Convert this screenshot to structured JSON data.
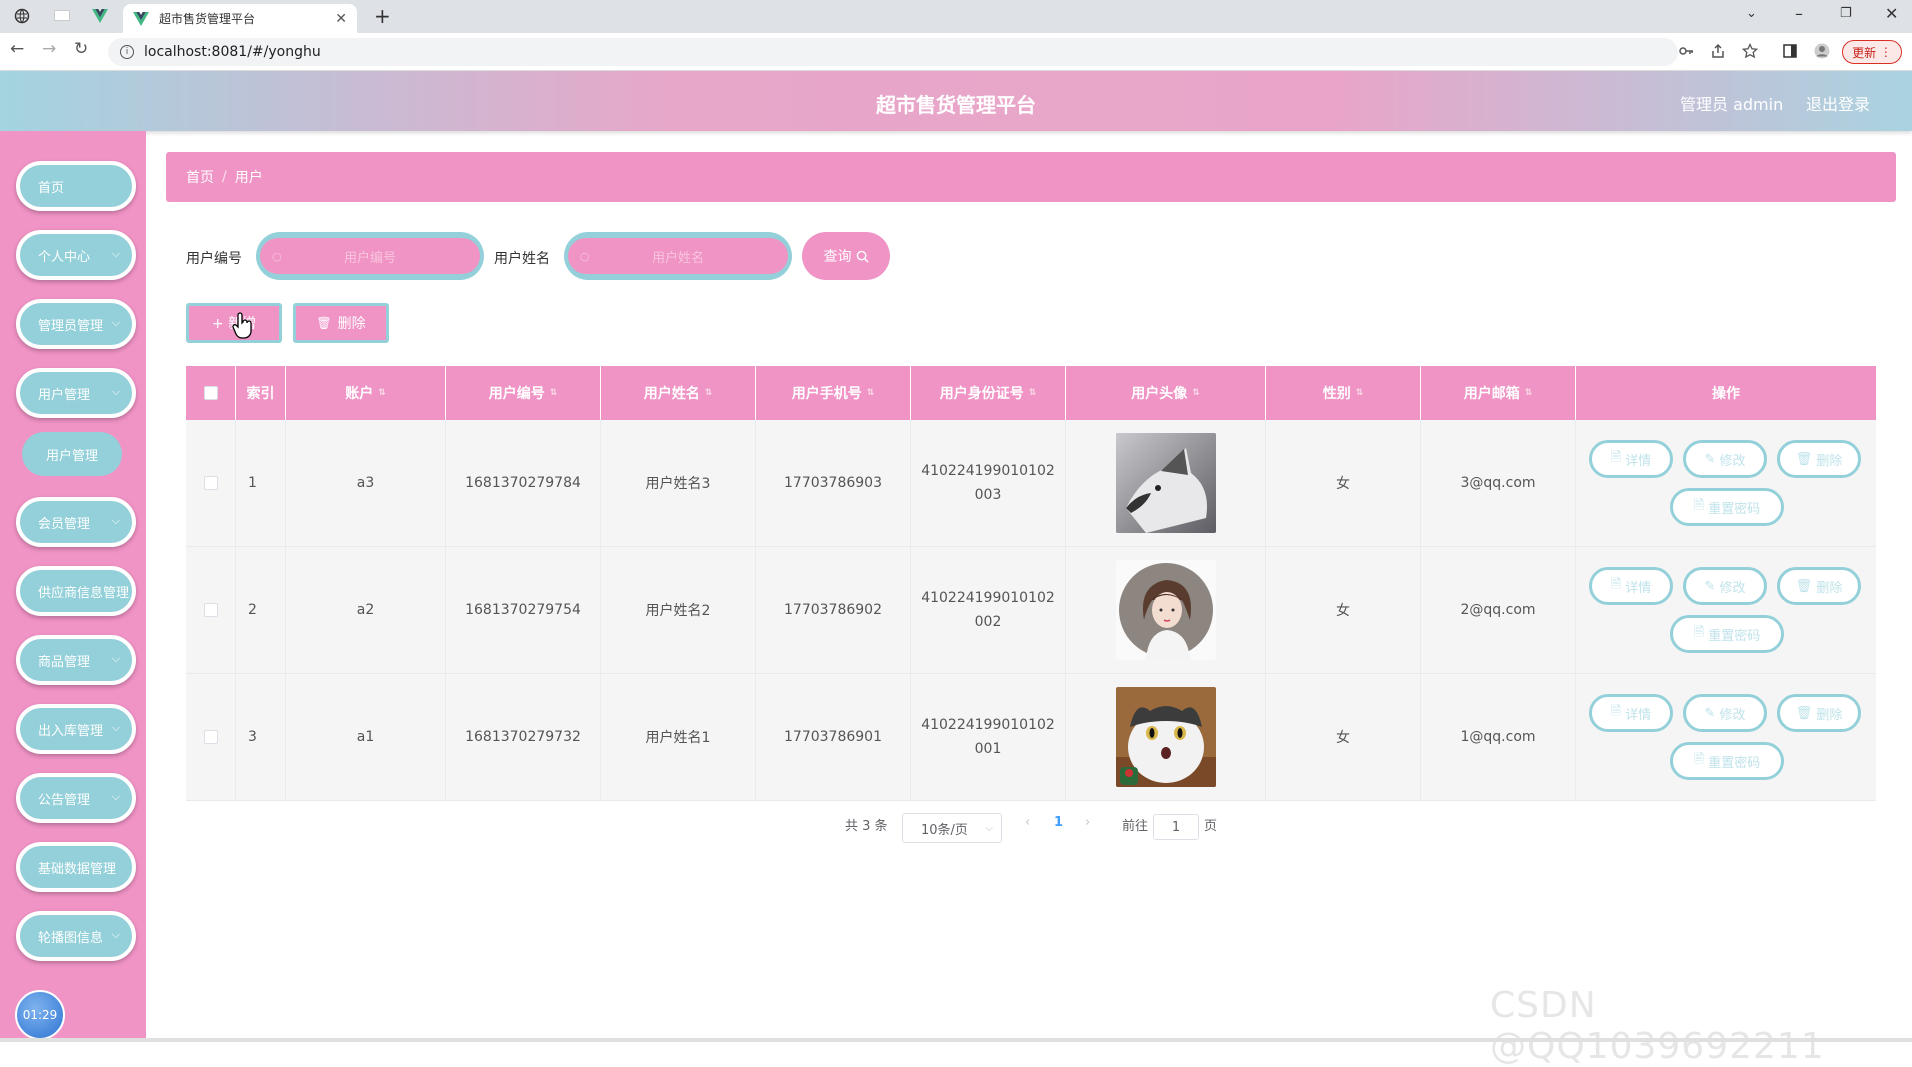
{
  "browser": {
    "tab_title": "超市售货管理平台",
    "url": "localhost:8081/#/yonghu",
    "update_label": "更新"
  },
  "header": {
    "title": "超市售货管理平台",
    "admin_label": "管理员 admin",
    "logout_label": "退出登录"
  },
  "sidebar": {
    "items": [
      {
        "label": "首页"
      },
      {
        "label": "个人中心"
      },
      {
        "label": "管理员管理"
      },
      {
        "label": "用户管理"
      },
      {
        "label": "用户管理"
      },
      {
        "label": "会员管理"
      },
      {
        "label": "供应商信息管理"
      },
      {
        "label": "商品管理"
      },
      {
        "label": "出入库管理"
      },
      {
        "label": "公告管理"
      },
      {
        "label": "基础数据管理"
      },
      {
        "label": "轮播图信息"
      }
    ],
    "clock": "01:29"
  },
  "breadcrumb": {
    "home": "首页",
    "sep": "/",
    "current": "用户"
  },
  "search": {
    "field1_label": "用户编号",
    "field1_placeholder": "用户编号",
    "field2_label": "用户姓名",
    "field2_placeholder": "用户姓名",
    "query_label": "查询"
  },
  "actions": {
    "add_label": "+ 新增",
    "delete_label": "删除"
  },
  "table": {
    "headers": [
      "索引",
      "账户",
      "用户编号",
      "用户姓名",
      "用户手机号",
      "用户身份证号",
      "用户头像",
      "性别",
      "用户邮箱",
      "操作"
    ],
    "rows": [
      {
        "index": "1",
        "account": "a3",
        "number": "1681370279784",
        "name": "用户姓名3",
        "phone": "17703786903",
        "id_card": "410224199010102003",
        "gender": "女",
        "email": "3@qq.com",
        "avatar": "husky-photo"
      },
      {
        "index": "2",
        "account": "a2",
        "number": "1681370279754",
        "name": "用户姓名2",
        "phone": "17703786902",
        "id_card": "410224199010102002",
        "gender": "女",
        "email": "2@qq.com",
        "avatar": "girl-illustration"
      },
      {
        "index": "3",
        "account": "a1",
        "number": "1681370279732",
        "name": "用户姓名1",
        "phone": "17703786901",
        "id_card": "410224199010102001",
        "gender": "女",
        "email": "1@qq.com",
        "avatar": "cat-photo"
      }
    ],
    "op_labels": {
      "detail": "详情",
      "edit": "修改",
      "delete": "删除",
      "reset": "重置密码"
    }
  },
  "pagination": {
    "total": "共 3 条",
    "page_size": "10条/页",
    "current_page": "1",
    "goto_label": "前往",
    "goto_value": "1",
    "page_suffix": "页"
  },
  "watermark": "CSDN @QQ1039692211",
  "colors": {
    "pink": "#f093c5",
    "teal": "#93d0d9"
  }
}
